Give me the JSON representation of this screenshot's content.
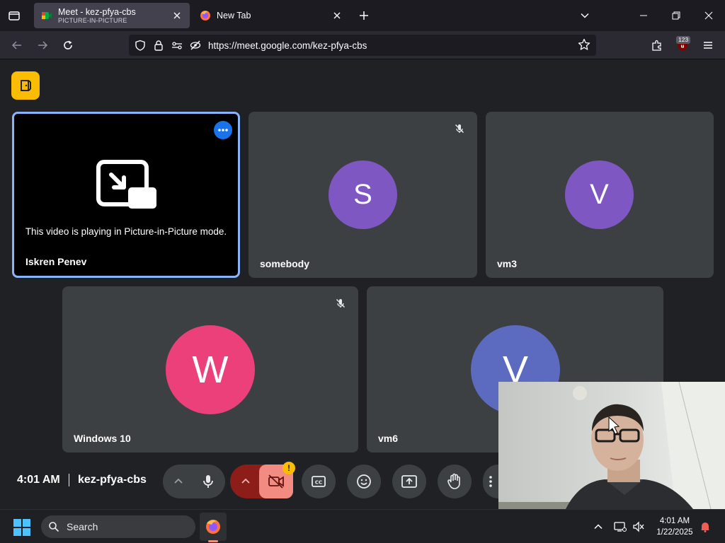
{
  "browser": {
    "tabs": [
      {
        "title": "Meet - kez-pfya-cbs",
        "subtitle": "PICTURE-IN-PICTURE",
        "active": true
      },
      {
        "title": "New Tab",
        "active": false
      }
    ],
    "url": "https://meet.google.com/kez-pfya-cbs",
    "extension_badge": "123",
    "icons": {
      "tab_list": "tab-list-icon",
      "new_tab": "plus-icon",
      "list_all_tabs": "chevron-down-icon",
      "back": "arrow-left-icon",
      "forward": "arrow-right-icon",
      "reload": "reload-icon",
      "shield": "shield-icon",
      "lock": "lock-icon",
      "permissions": "permissions-icon",
      "tracking": "tracking-off-icon",
      "bookmark": "star-icon",
      "extensions": "puzzle-icon",
      "menu": "hamburger-icon"
    }
  },
  "meet": {
    "tiles": [
      {
        "name": "Iskren Penev",
        "pip_message": "This video is playing in Picture-in-Picture mode.",
        "active_speaker": true
      },
      {
        "name": "somebody",
        "initial": "S",
        "color": "#7e57c2",
        "muted": true
      },
      {
        "name": "vm3",
        "initial": "V",
        "color": "#7e57c2",
        "muted": false
      },
      {
        "name": "Windows 10",
        "initial": "W",
        "color": "#ec407a",
        "muted": true
      },
      {
        "name": "vm6",
        "initial": "V",
        "color": "#5c6bc0",
        "muted": false
      }
    ],
    "time": "4:01 AM",
    "meeting_code": "kez-pfya-cbs",
    "camera_warning": "!",
    "controls": [
      "chevron-up-icon",
      "mic-icon",
      "chevron-up-icon",
      "camera-off-icon",
      "captions-icon",
      "emoji-icon",
      "present-icon",
      "raise-hand-icon",
      "more-vert-icon"
    ]
  },
  "taskbar": {
    "search_label": "Search",
    "time": "4:01 AM",
    "date": "1/22/2025"
  },
  "colors": {
    "meet_bg": "#202124",
    "tile_bg": "#3c4043",
    "active_border": "#8ab4f8",
    "camera_off_bg": "#f28b82",
    "logo_yellow": "#fbbc04"
  }
}
